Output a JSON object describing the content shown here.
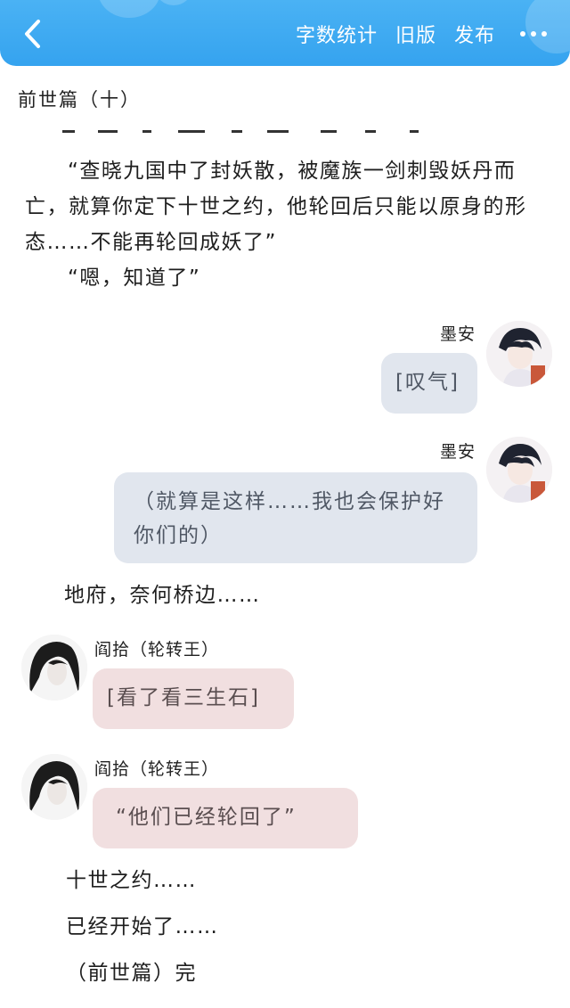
{
  "header": {
    "back_icon": "chevron-left-icon",
    "word_count_label": "字数统计",
    "old_version_label": "旧版",
    "publish_label": "发布",
    "more_icon": "more-dots-icon",
    "background_color": "#3aa8f2"
  },
  "chapter_title": "前世篇（十）",
  "messages": {
    "narration_1": "“查晓九国中了封妖散，被魔族一剑刺毁妖丹而亡，就算你定下十世之约，他轮回后只能以原身的形态……不能再轮回成妖了”",
    "narration_2": "“嗯，知道了”",
    "moan_1": {
      "speaker": "墨安",
      "text": "[叹气]"
    },
    "moan_2": {
      "speaker": "墨安",
      "text": "（就算是这样……我也会保护好你们的）"
    },
    "narration_3": "地府，奈何桥边……",
    "yan_1": {
      "speaker": "阎拾（轮转王）",
      "text": "[看了看三生石]"
    },
    "yan_2": {
      "speaker": "阎拾（轮转王）",
      "text": "“他们已经轮回了”"
    },
    "narration_4": "十世之约……",
    "narration_5": "已经开始了……",
    "narration_6": "（前世篇）完"
  },
  "colors": {
    "bubble_right": "#e1e6ee",
    "bubble_left": "#f1dfe0"
  }
}
